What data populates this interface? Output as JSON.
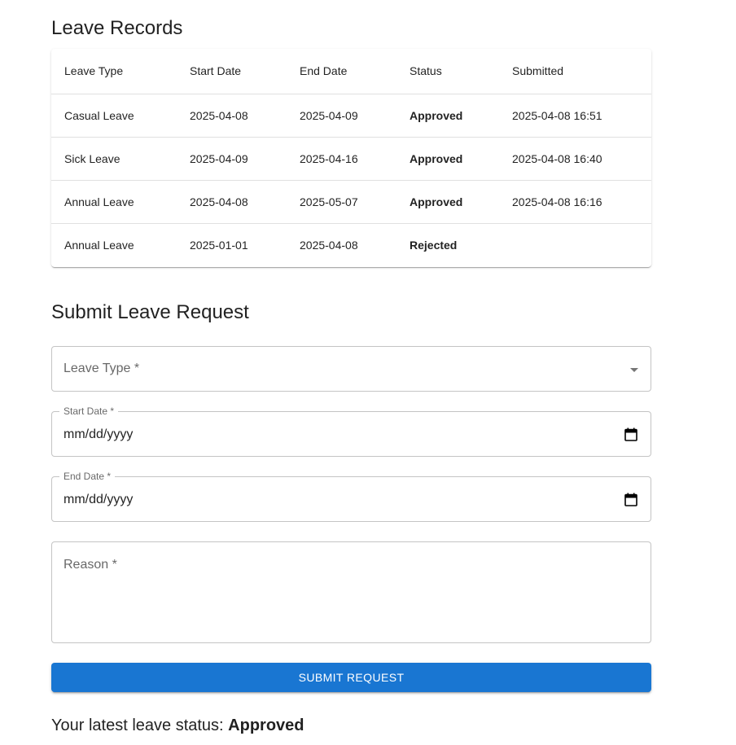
{
  "records": {
    "title": "Leave Records",
    "columns": [
      "Leave Type",
      "Start Date",
      "End Date",
      "Status",
      "Submitted"
    ],
    "rows": [
      [
        "Casual Leave",
        "2025-04-08",
        "2025-04-09",
        "Approved",
        "2025-04-08 16:51"
      ],
      [
        "Sick Leave",
        "2025-04-09",
        "2025-04-16",
        "Approved",
        "2025-04-08 16:40"
      ],
      [
        "Annual Leave",
        "2025-04-08",
        "2025-05-07",
        "Approved",
        "2025-04-08 16:16"
      ],
      [
        "Annual Leave",
        "2025-01-01",
        "2025-04-08",
        "Rejected",
        ""
      ]
    ]
  },
  "form": {
    "title": "Submit Leave Request",
    "leave_type_label": "Leave Type *",
    "leave_type_value": "",
    "start_date_label": "Start Date *",
    "start_date_value": "mm/dd/yyyy",
    "end_date_label": "End Date *",
    "end_date_value": "mm/dd/yyyy",
    "reason_label": "Reason *",
    "reason_value": "",
    "submit_label": "SUBMIT REQUEST"
  },
  "latest": {
    "prefix": "Your latest leave status: ",
    "status": "Approved"
  },
  "colors": {
    "primary": "#1976d2"
  },
  "icons": {
    "leave_type": "chevron-down-icon",
    "date": "calendar-icon"
  }
}
